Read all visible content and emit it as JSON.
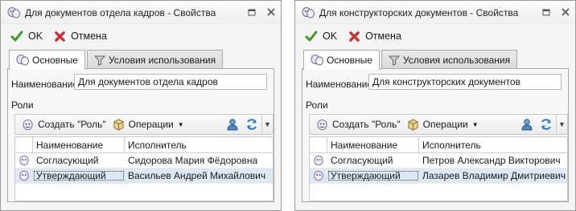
{
  "windows": [
    {
      "title": "Для документов отдела кадров - Свойства",
      "actions": {
        "ok": "OK",
        "cancel": "Отмена"
      },
      "tabs": [
        "Основные",
        "Условия использования"
      ],
      "name_label": "Наименование",
      "name_value": "Для документов отдела кадров",
      "roles_label": "Роли",
      "toolbar": {
        "create_role": "Создать \"Роль\"",
        "operations": "Операции"
      },
      "columns": [
        "Наименование",
        "Исполнитель"
      ],
      "rows": [
        {
          "name": "Согласующий",
          "executor": "Сидорова Мария Фёдоровна"
        },
        {
          "name": "Утверждающий",
          "executor": "Васильев Андрей Михайлович"
        }
      ]
    },
    {
      "title": "Для конструкторских документов - Свойства",
      "actions": {
        "ok": "OK",
        "cancel": "Отмена"
      },
      "tabs": [
        "Основные",
        "Условия использования"
      ],
      "name_label": "Наименование",
      "name_value": "Для конструкторских документов",
      "roles_label": "Роли",
      "toolbar": {
        "create_role": "Создать \"Роль\"",
        "operations": "Операции"
      },
      "columns": [
        "Наименование",
        "Исполнитель"
      ],
      "rows": [
        {
          "name": "Согласующий",
          "executor": "Петров Александр Викторович"
        },
        {
          "name": "Утверждающий",
          "executor": "Лазарев Владимир Дмитриевич"
        }
      ]
    }
  ],
  "icons": {
    "app": "masks-icon",
    "ok": "checkmark-icon",
    "cancel": "red-x-icon",
    "tab_main": "masks-icon",
    "tab_conditions": "funnel-icon",
    "create_role": "mask-icon",
    "operations": "cube-icon",
    "user": "user-icon",
    "refresh": "refresh-icon",
    "row": "mask-icon"
  },
  "colors": {
    "ok_green": "#3a9a1e",
    "cancel_red": "#d42a2a",
    "selected_row": "#dde8f5"
  }
}
